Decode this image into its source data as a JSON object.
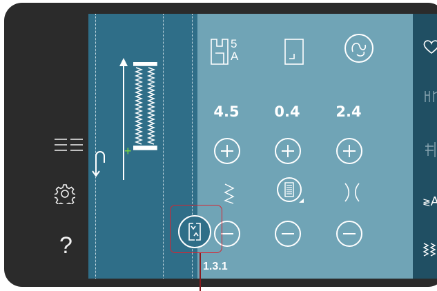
{
  "left_bar": {
    "items": [
      {
        "name": "menu-list-icon",
        "glyph": "☰"
      },
      {
        "name": "settings-gear-icon",
        "glyph": "⚙"
      },
      {
        "name": "help-icon",
        "glyph": "?"
      }
    ]
  },
  "stitch_view": {
    "reverse_icon": "reverse-stitch-icon"
  },
  "settings": {
    "values": [
      "4.5",
      "0.4",
      "2.4"
    ],
    "top_icons": [
      "presser-foot-5a-icon",
      "stitch-area-icon",
      "free-motion-icon"
    ],
    "mid_icons": [
      "stitch-width-icon",
      "stitch-density-icon",
      "stitch-positioning-icon"
    ],
    "pattern_number": "1.3.1",
    "foot_label_number": "5",
    "foot_label_letter": "A",
    "secondary_button": "stitch-program-icon"
  },
  "right_bar": {
    "items": [
      "favorite-heart-icon",
      "tie-off-icon",
      "cutter-icon",
      "font-icon",
      "stitch-sequencing-icon"
    ],
    "font_label": "A"
  },
  "colors": {
    "frame": "#2b2b2b",
    "stitch_bg": "#2f6e88",
    "panel_bg": "#70a4b6",
    "right_bar_bg": "#204f63",
    "highlight": "#d9232f"
  }
}
